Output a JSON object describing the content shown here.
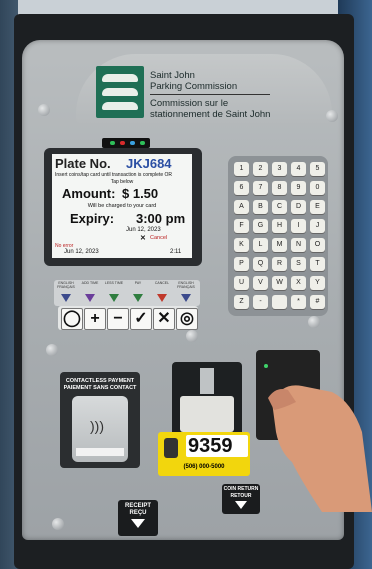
{
  "header": {
    "org_en_line1": "Saint John",
    "org_en_line2": "Parking Commission",
    "org_fr_line1": "Commission sur le",
    "org_fr_line2": "stationnement de Saint John"
  },
  "screen": {
    "plate_label": "Plate No.",
    "plate_value": "JKJ684",
    "instruction": "Insert coins/tap card until transaction is complete OR",
    "instruction2": "Tap below",
    "amount_label": "Amount:",
    "amount_value": "$ 1.50",
    "charge_note": "Will be charged to your card",
    "expiry_label": "Expiry:",
    "expiry_time": "3:00 pm",
    "expiry_date": "Jun 12, 2023",
    "cancel_label": "Cancel",
    "status_left": "No error",
    "date_left": "Jun 12, 2023",
    "time_right": "2:11"
  },
  "leds": {
    "colors": [
      "#2fbf5a",
      "#d92b2b",
      "#3aa0e0",
      "#2fbf5a"
    ]
  },
  "keypad": {
    "keys": [
      "1",
      "2",
      "3",
      "4",
      "5",
      "6",
      "7",
      "8",
      "9",
      "0",
      "A",
      "B",
      "C",
      "D",
      "E",
      "F",
      "G",
      "H",
      "I",
      "J",
      "K",
      "L",
      "M",
      "N",
      "O",
      "P",
      "Q",
      "R",
      "S",
      "T",
      "U",
      "V",
      "W",
      "X",
      "Y",
      "Z",
      "-",
      "",
      "*",
      "#"
    ]
  },
  "function_strip": {
    "labels": [
      "ENGLISH FRANÇAIS",
      "ADD TIME",
      "LESS TIME",
      "PAY",
      "CANCEL",
      "ENGLISH FRANÇAIS"
    ],
    "arrow_colors": [
      "#3b4a8c",
      "#6a3d9a",
      "#2f7d3f",
      "#2f7d3f",
      "#c0392b",
      "#3b4a8c"
    ]
  },
  "buttons": {
    "symbols": [
      "◯",
      "+",
      "−",
      "✓",
      "✕",
      "◎"
    ]
  },
  "payment": {
    "contactless_line1": "CONTACTLESS PAYMENT",
    "contactless_line2": "PAIEMENT SANS CONTACT"
  },
  "zone_sign": {
    "number": "9359",
    "phone": "(506) 000-5000"
  },
  "receipt": {
    "line1": "RECEIPT",
    "line2": "REÇU"
  },
  "coin_return": {
    "line1": "COIN RETURN",
    "line2": "RETOUR"
  }
}
